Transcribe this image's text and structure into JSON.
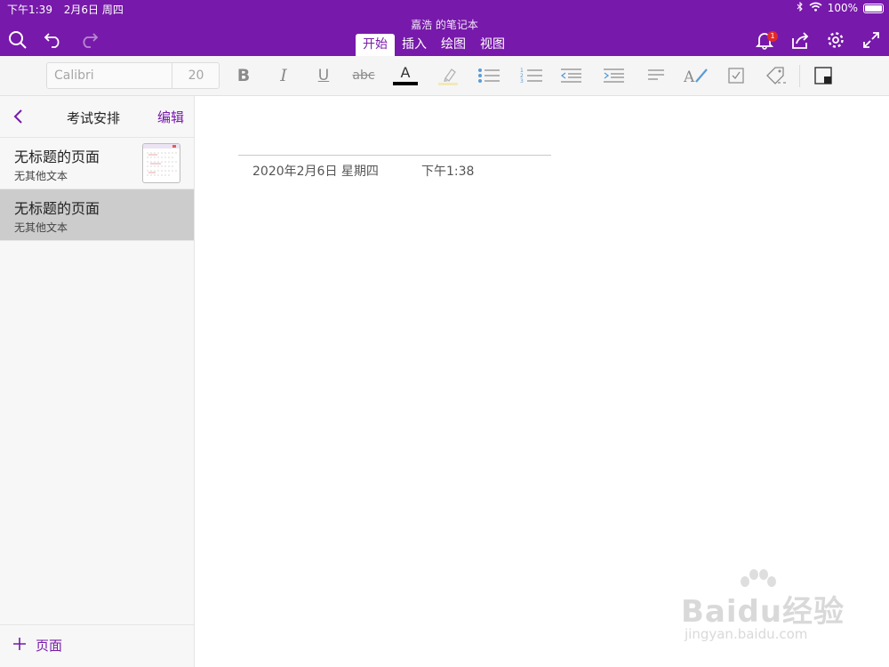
{
  "status_bar": {
    "time": "下午1:39",
    "date": "2月6日 周四",
    "battery": "100%"
  },
  "notebook_title": "嘉浩 的笔记本",
  "tabs": [
    {
      "label": "开始",
      "active": true
    },
    {
      "label": "插入",
      "active": false
    },
    {
      "label": "绘图",
      "active": false
    },
    {
      "label": "视图",
      "active": false
    }
  ],
  "notification_count": "1",
  "toolbar": {
    "font_name": "Calibri",
    "font_size": "20",
    "strike_label": "abc",
    "font_color_letter": "A"
  },
  "sidebar": {
    "section_title": "考试安排",
    "edit_label": "编辑",
    "pages": [
      {
        "title": "无标题的页面",
        "subtitle": "无其他文本",
        "selected": false,
        "has_thumbnail": true
      },
      {
        "title": "无标题的页面",
        "subtitle": "无其他文本",
        "selected": true,
        "has_thumbnail": false
      }
    ],
    "add_page_label": "页面"
  },
  "page": {
    "date": "2020年2月6日 星期四",
    "time": "下午1:38"
  },
  "watermark": {
    "main": "Baidu经验",
    "sub": "jingyan.baidu.com"
  },
  "colors": {
    "accent": "#7719aa",
    "selected_row": "#cccccc",
    "badge": "#e02a2a"
  }
}
